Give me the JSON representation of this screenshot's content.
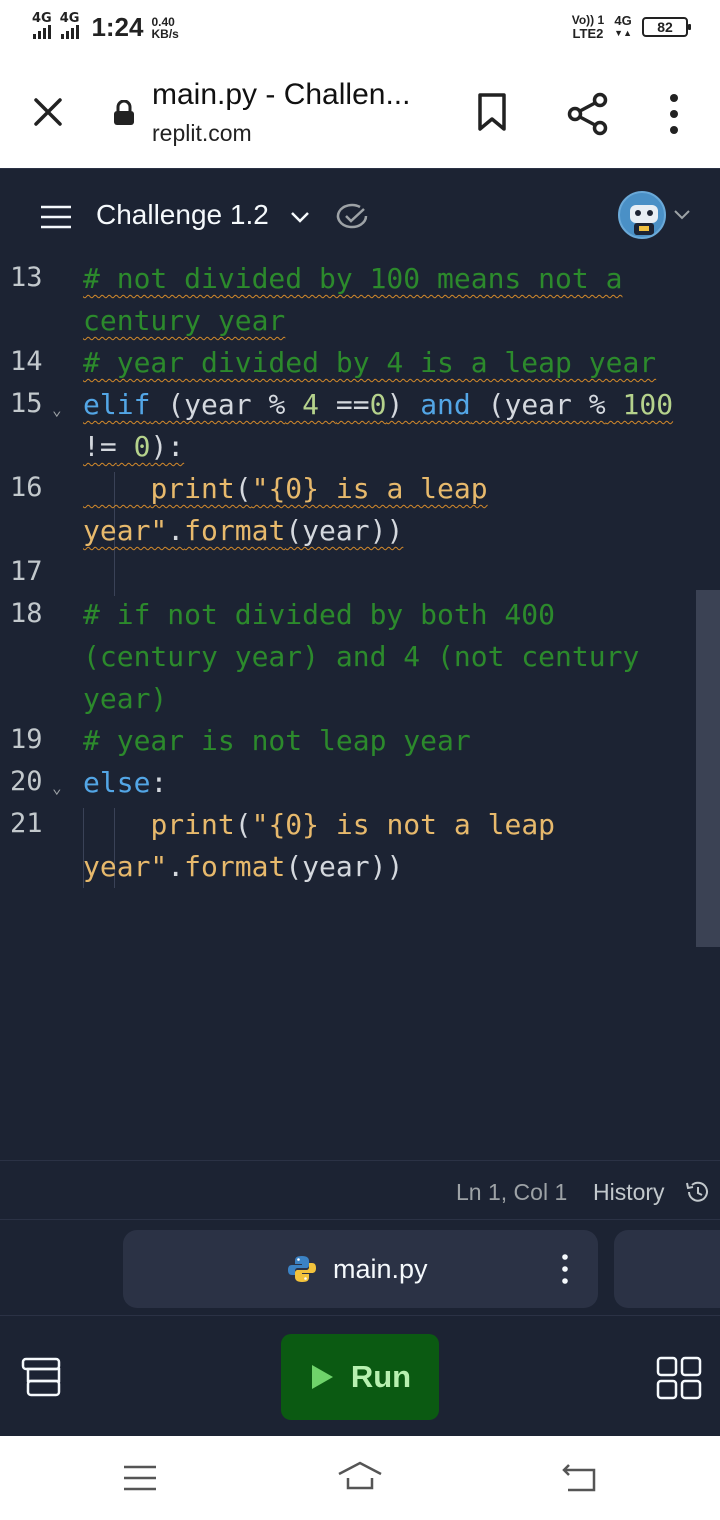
{
  "status_bar": {
    "network1": "4G",
    "network2": "4G",
    "time": "1:24",
    "speed_value": "0.40",
    "speed_unit": "KB/s",
    "volte": "Vo)) 1",
    "lte": "LTE2",
    "network3": "4G",
    "battery": "82"
  },
  "browser": {
    "page_title": "main.py - Challen...",
    "host": "replit.com"
  },
  "workspace": {
    "project_name": "Challenge 1.2"
  },
  "editor": {
    "lines": [
      {
        "number": "13",
        "foldable": false
      },
      {
        "number": "14",
        "foldable": false
      },
      {
        "number": "15",
        "foldable": true
      },
      {
        "number": "16",
        "foldable": false
      },
      {
        "number": "17",
        "foldable": false
      },
      {
        "number": "18",
        "foldable": false
      },
      {
        "number": "19",
        "foldable": false
      },
      {
        "number": "20",
        "foldable": true
      },
      {
        "number": "21",
        "foldable": false
      }
    ],
    "code": {
      "l13a": "# not divided by 100 means not a",
      "l13b": "century year",
      "l14": "# year divided by 4 is a leap year",
      "l15_kw1": "elif",
      "l15_p1": " (year ",
      "l15_op1": "%",
      "l15_n1": " 4 ",
      "l15_op2": "==",
      "l15_n2": "0",
      "l15_p2": ") ",
      "l15_kw2": "and",
      "l15_p3": " (year ",
      "l15_op3": "%",
      "l15_n3": " 100",
      "l15b_op": "!=",
      "l15b_n": " 0",
      "l15b_p": "):",
      "l16_fn": "print",
      "l16_p1": "(",
      "l16_str": "\"{0} is a leap",
      "l16b_str": "year\"",
      "l16b_rest1": ".",
      "l16b_fn": "format",
      "l16b_rest2": "(year))",
      "l18a": "# if not divided by both 400",
      "l18b": "(century year) and 4 (not century",
      "l18c": "year)",
      "l19": "# year is not leap year",
      "l20_kw": "else",
      "l20_p": ":",
      "l21_fn": "print",
      "l21_p1": "(",
      "l21_str": "\"{0} is not a leap",
      "l21b_str": "year\"",
      "l21b_rest1": ".",
      "l21b_fn": "format",
      "l21b_rest2": "(year))"
    }
  },
  "status_line": {
    "cursor": "Ln 1, Col 1",
    "history_label": "History"
  },
  "tabs": {
    "active_file": "main.py"
  },
  "toolbar": {
    "run_label": "Run"
  },
  "colors": {
    "background": "#1c2333",
    "comment": "#2c8a2c",
    "keyword": "#53a6e6",
    "string": "#e7b96c",
    "number": "#b5d28c",
    "run_button": "#0b5a12"
  }
}
